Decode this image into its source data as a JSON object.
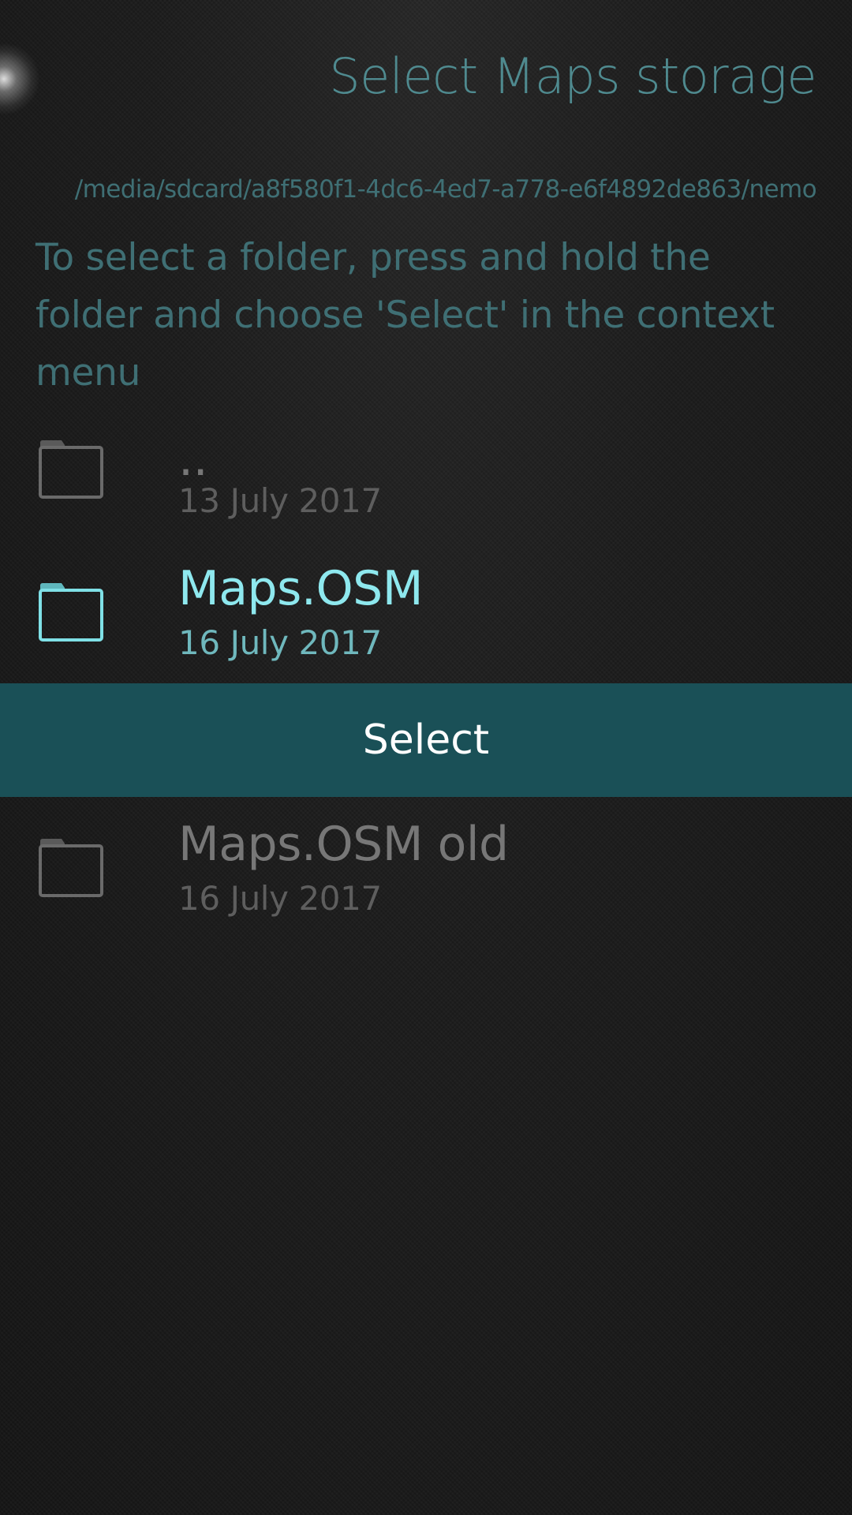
{
  "header": {
    "title": "Select Maps storage"
  },
  "current_path": "/media/sdcard/a8f580f1-4dc6-4ed7-a778-e6f4892de863/nemo",
  "instructions": "To select a folder, press and hold the folder and choose 'Select' in the context menu",
  "folders": [
    {
      "name": "..",
      "date": "13 July 2017",
      "icon": "folder-icon",
      "state": "normal"
    },
    {
      "name": "Maps.OSM",
      "date": "16 July 2017",
      "icon": "folder-icon",
      "state": "highlighted"
    },
    {
      "name": "Maps.OSM old",
      "date": "16 July 2017",
      "icon": "folder-icon",
      "state": "normal"
    }
  ],
  "context_menu": {
    "select_label": "Select"
  },
  "colors": {
    "accent": "#8ee8ee",
    "header_text": "#4f8a8f",
    "secondary_text": "#3f6f74",
    "context_menu_bg": "#1a5057",
    "dim_text": "#777777"
  }
}
